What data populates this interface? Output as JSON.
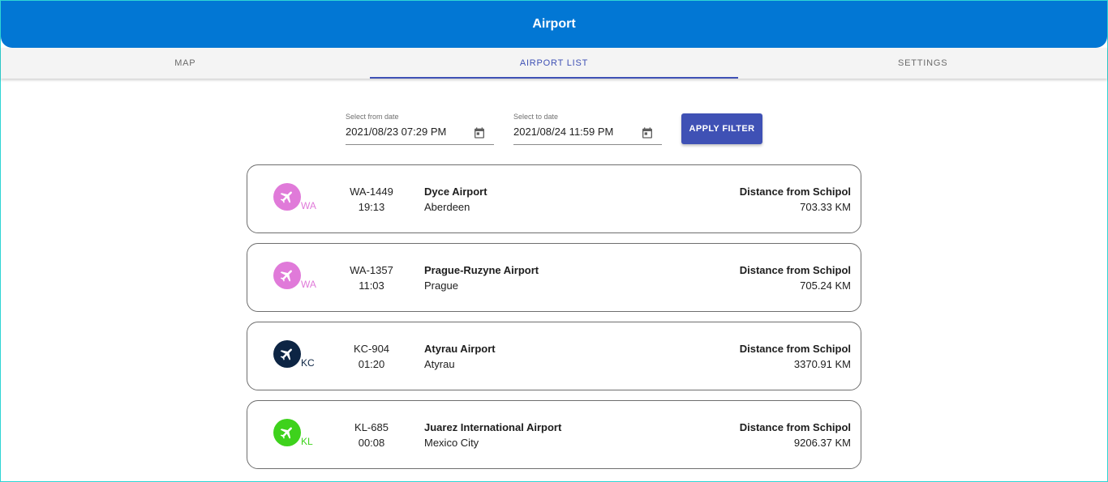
{
  "app": {
    "title": "Airport"
  },
  "tabs": [
    {
      "label": "MAP"
    },
    {
      "label": "AIRPORT LIST"
    },
    {
      "label": "SETTINGS"
    }
  ],
  "filter": {
    "from_label": "Select from date",
    "from_value": "2021/08/23 07:29 PM",
    "to_label": "Select to date",
    "to_value": "2021/08/24 11:59 PM",
    "apply_label": "APPLY FILTER",
    "calendar_icon": "calendar-icon"
  },
  "colors": {
    "appbar": "#0277d4",
    "accent": "#3f51b5",
    "WA": "#e07ad9",
    "KC": "#0d2544",
    "KL": "#3ed21c"
  },
  "flights": [
    {
      "airline": "WA",
      "flight_no": "WA-1449",
      "time": "19:13",
      "airport": "Dyce Airport",
      "city": "Aberdeen",
      "distance_label": "Distance from Schipol",
      "distance": "703.33 KM",
      "icon": "airplane-icon"
    },
    {
      "airline": "WA",
      "flight_no": "WA-1357",
      "time": "11:03",
      "airport": "Prague-Ruzyne Airport",
      "city": "Prague",
      "distance_label": "Distance from Schipol",
      "distance": "705.24 KM",
      "icon": "airplane-icon"
    },
    {
      "airline": "KC",
      "flight_no": "KC-904",
      "time": "01:20",
      "airport": "Atyrau Airport",
      "city": "Atyrau",
      "distance_label": "Distance from Schipol",
      "distance": "3370.91 KM",
      "icon": "airplane-icon"
    },
    {
      "airline": "KL",
      "flight_no": "KL-685",
      "time": "00:08",
      "airport": "Juarez International Airport",
      "city": "Mexico City",
      "distance_label": "Distance from Schipol",
      "distance": "9206.37 KM",
      "icon": "airplane-icon"
    }
  ]
}
